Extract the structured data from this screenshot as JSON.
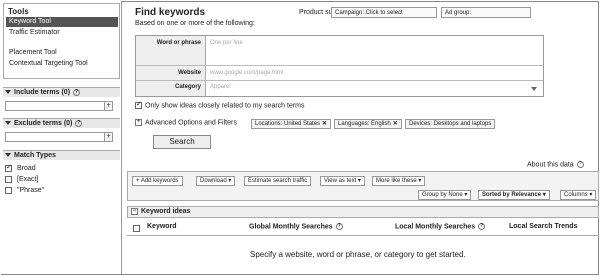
{
  "sidebar": {
    "tools_title": "Tools",
    "tools": [
      {
        "label": "Keyword Tool",
        "active": true
      },
      {
        "label": "Traffic Estimator",
        "active": false
      },
      {
        "label": "Placement Tool",
        "active": false
      },
      {
        "label": "Contextual Targeting Tool",
        "active": false
      }
    ],
    "include_terms": "Include terms",
    "exclude_terms": "Exclude terms",
    "include_help": "(0)",
    "exclude_help": "(0)",
    "match_types_title": "Match Types",
    "match_types": [
      {
        "label": "Broad",
        "checked": true
      },
      {
        "label": "[Exact]",
        "checked": false
      },
      {
        "label": "\"Phrase\"",
        "checked": false
      }
    ],
    "plus": "+"
  },
  "header": {
    "title": "Find keywords",
    "subtitle": "Based on one or more of the following:",
    "product_survey": "Product survey",
    "campaign_label": "Campaign: Click to select",
    "adgroup_label": "Ad group:"
  },
  "form": {
    "word_label": "Word or phrase",
    "word_placeholder": "One per line",
    "website_label": "Website",
    "website_placeholder": "www.google.com/page.html",
    "category_label": "Category",
    "category_placeholder": "Apparel"
  },
  "options": {
    "only_show": "Only show ideas closely related to my search terms",
    "advanced": "Advanced Options and Filters",
    "chips": [
      "Locations: United States",
      "Languages: English",
      "Devices: Desktops and laptops"
    ],
    "chip_x": "✕"
  },
  "search_button": "Search",
  "about_data": "About this data",
  "toolbar": {
    "row1": [
      "+ Add keywords",
      "Download ▾",
      "Estimate search traffic",
      "View as text ▾",
      "More like these ▾"
    ],
    "row2": [
      "Group by None ▾",
      "Sorted by Relevance ▾",
      "Columns ▾"
    ]
  },
  "ideas": {
    "title": "Keyword ideas",
    "minus": "−",
    "columns": [
      "Keyword",
      "Global Monthly Searches",
      "Local Monthly Searches",
      "Local Search Trends"
    ],
    "empty_message": "Specify a website, word or phrase, or category to get started."
  },
  "help_icon": "?"
}
